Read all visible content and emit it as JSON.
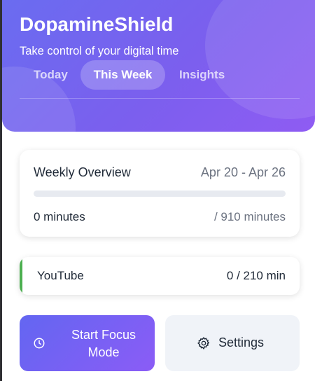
{
  "header": {
    "app_title": "DopamineShield",
    "tagline": "Take control of your digital time",
    "tabs": [
      {
        "label": "Today",
        "active": false
      },
      {
        "label": "This Week",
        "active": true
      },
      {
        "label": "Insights",
        "active": false
      }
    ]
  },
  "overview": {
    "title": "Weekly Overview",
    "date_range": "Apr 20 - Apr 26",
    "used": "0 minutes",
    "total": "/ 910 minutes",
    "progress_fraction": 0
  },
  "sites": [
    {
      "name": "YouTube",
      "usage": "0 / 210 min",
      "accent_color": "#4caf50"
    }
  ],
  "actions": {
    "focus_label": "Start Focus Mode",
    "focus_icon": "clock-icon",
    "settings_label": "Settings",
    "settings_icon": "gear-icon"
  },
  "colors": {
    "accent_start": "#6366f1",
    "accent_end": "#8b5cf6"
  }
}
